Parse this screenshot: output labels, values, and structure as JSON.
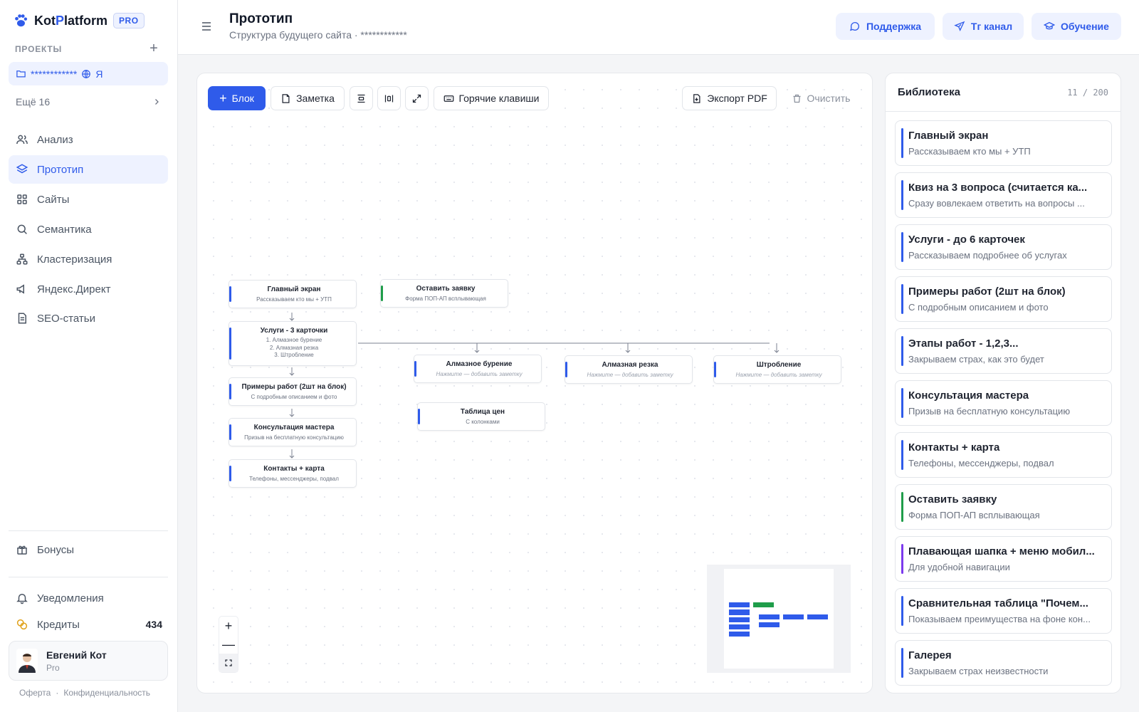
{
  "brand": {
    "name_a": "Kot",
    "name_b": "P",
    "name_c": "latform",
    "badge": "PRO"
  },
  "sidebar": {
    "projects_label": "ПРОЕКТЫ",
    "add_symbol": "+",
    "active_project": "************",
    "active_project_suffix": "Я",
    "more_label": "Ещё 16",
    "nav": [
      {
        "label": "Анализ",
        "icon": "users-icon"
      },
      {
        "label": "Прототип",
        "icon": "layers-icon"
      },
      {
        "label": "Сайты",
        "icon": "grid-icon"
      },
      {
        "label": "Семантика",
        "icon": "search-icon"
      },
      {
        "label": "Кластеризация",
        "icon": "cluster-icon"
      },
      {
        "label": "Яндекс.Директ",
        "icon": "megaphone-icon"
      },
      {
        "label": "SEO-статьи",
        "icon": "document-icon"
      }
    ],
    "bonuses": "Бонусы",
    "notifications": "Уведомления",
    "credits": "Кредиты",
    "credits_value": "434",
    "user_name": "Евгений Кот",
    "user_plan": "Pro",
    "footer_offer": "Оферта",
    "footer_sep": "·",
    "footer_privacy": "Конфиденциальность"
  },
  "header": {
    "title": "Прототип",
    "subtitle": "Структура будущего сайта · ************",
    "support": "Поддержка",
    "tg": "Тг канал",
    "learning": "Обучение"
  },
  "toolbar": {
    "block": "Блок",
    "note": "Заметка",
    "hotkeys": "Горячие клавиши",
    "export": "Экспорт PDF",
    "clear": "Очистить"
  },
  "canvas": {
    "nodes": {
      "main": {
        "title": "Главный экран",
        "sub": "Рассказываем кто мы + УТП"
      },
      "services": {
        "title": "Услуги - 3 карточки",
        "lines": [
          "1. Алмазное бурение",
          "2. Алмазная резка",
          "3.    Штробление"
        ]
      },
      "examples": {
        "title": "Примеры работ (2шт на блок)",
        "sub": "С подробным описанием и фото"
      },
      "consult": {
        "title": "Консультация мастера",
        "sub": "Призыв на бесплатную консультацию"
      },
      "contacts": {
        "title": "Контакты + карта",
        "sub": "Телефоны, мессенджеры, подвал"
      },
      "request": {
        "title": "Оставить заявку",
        "sub": "Форма ПОП-АП всплывающая"
      },
      "drill": {
        "title": "Алмазное бурение",
        "sub": "Нажмите — добавить заметку"
      },
      "cut": {
        "title": "Алмазная резка",
        "sub": "Нажмите — добавить заметку"
      },
      "chase": {
        "title": "Штробление",
        "sub": "Нажмите — добавить заметку"
      },
      "prices": {
        "title": "Таблица цен",
        "sub": "С колонками"
      }
    },
    "zoom_in": "+",
    "zoom_out": "—"
  },
  "library": {
    "title": "Библиотека",
    "count": "11 / 200",
    "items": [
      {
        "title": "Главный экран",
        "sub": "Рассказываем кто мы + УТП",
        "color": "#2f5bea"
      },
      {
        "title": "Квиз на 3 вопроса (считается ка...",
        "sub": "Сразу вовлекаем ответить на вопросы ...",
        "color": "#2f5bea"
      },
      {
        "title": "Услуги - до 6 карточек",
        "sub": "Рассказываем подробнее об услугах",
        "color": "#2f5bea"
      },
      {
        "title": "Примеры работ (2шт на блок)",
        "sub": "С подробным описанием и фото",
        "color": "#2f5bea"
      },
      {
        "title": "Этапы работ - 1,2,3...",
        "sub": "Закрываем страх, как это будет",
        "color": "#2f5bea"
      },
      {
        "title": "Консультация мастера",
        "sub": "Призыв на бесплатную консультацию",
        "color": "#2f5bea"
      },
      {
        "title": "Контакты + карта",
        "sub": "Телефоны, мессенджеры, подвал",
        "color": "#2f5bea"
      },
      {
        "title": "Оставить заявку",
        "sub": "Форма ПОП-АП всплывающая",
        "color": "#1f9d4a"
      },
      {
        "title": "Плавающая шапка + меню мобил...",
        "sub": "Для удобной навигации",
        "color": "#7c3aed"
      },
      {
        "title": "Сравнительная таблица \"Почем...",
        "sub": "Показываем преимущества на фоне кон...",
        "color": "#2f5bea"
      },
      {
        "title": "Галерея",
        "sub": "Закрываем страх неизвестности",
        "color": "#2f5bea"
      }
    ]
  },
  "colors": {
    "accent": "#2f5bea",
    "green": "#1f9d4a",
    "purple": "#7c3aed"
  }
}
